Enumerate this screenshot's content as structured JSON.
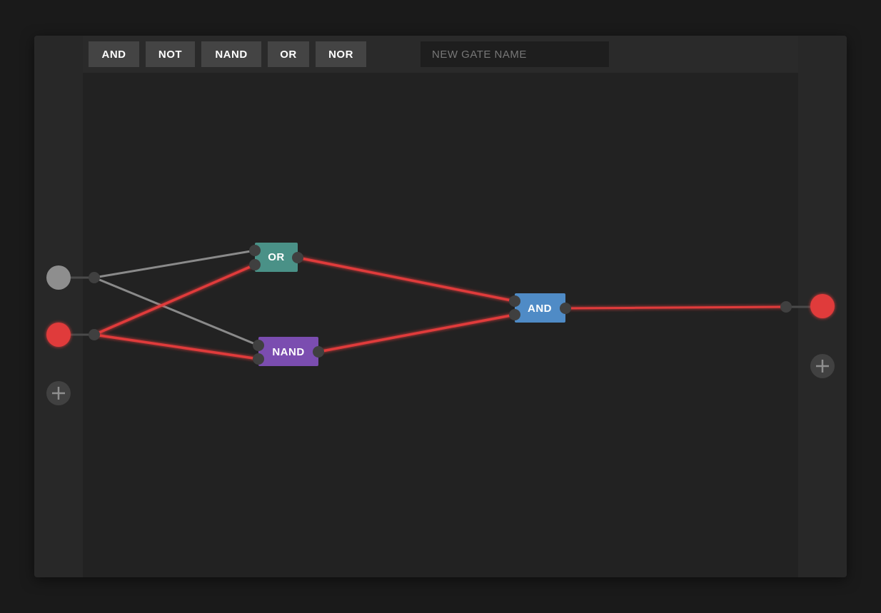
{
  "toolbar": {
    "buttons": [
      "AND",
      "NOT",
      "NAND",
      "OR",
      "NOR"
    ],
    "new_gate_placeholder": "NEW GATE NAME"
  },
  "circuit": {
    "inputs": [
      {
        "id": "input-1",
        "state": "off"
      },
      {
        "id": "input-2",
        "state": "on"
      }
    ],
    "outputs": [
      {
        "id": "output-1",
        "state": "on"
      }
    ],
    "gates": [
      {
        "id": "gate-or",
        "label": "OR",
        "color": "#4a9187"
      },
      {
        "id": "gate-nand",
        "label": "NAND",
        "color": "#7b4db0"
      },
      {
        "id": "gate-and",
        "label": "AND",
        "color": "#4f8bc6"
      }
    ],
    "wire_colors": {
      "off": "#8a8a8a",
      "on": "#e03a3a"
    },
    "add_input_icon": "plus-icon",
    "add_output_icon": "plus-icon"
  }
}
